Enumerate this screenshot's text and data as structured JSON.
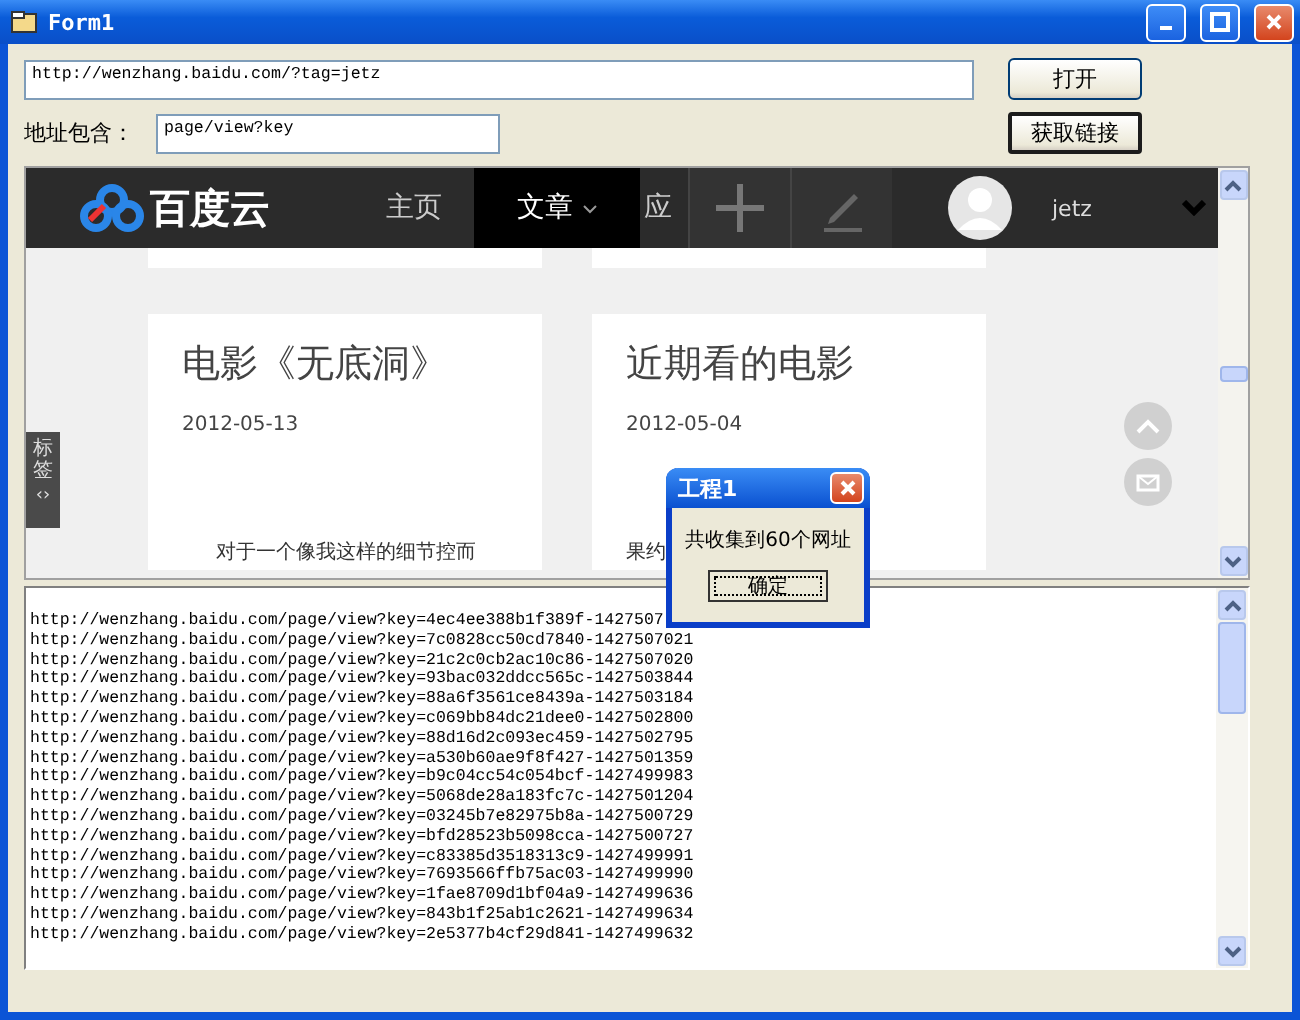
{
  "window": {
    "title": "Form1"
  },
  "url_field": {
    "value": "http://wenzhang.baidu.com/?tag=jetz"
  },
  "open_button": "打开",
  "filter": {
    "label": "地址包含：",
    "value": "page/view?key"
  },
  "fetch_button": "获取链接",
  "browser": {
    "nav": {
      "logo": "百度云",
      "items": [
        {
          "label": "主页",
          "selected": false,
          "dropdown": false
        },
        {
          "label": "文章",
          "selected": true,
          "dropdown": true
        },
        {
          "label": "应",
          "selected": false,
          "dropdown": false
        }
      ],
      "user": "jetz"
    },
    "side_tab": {
      "label": "标签",
      "arrows": "‹›"
    },
    "cards": [
      {
        "title": "电影《无底洞》",
        "date": "2012-05-13",
        "excerpt": "对于一个像我这样的细节控而"
      },
      {
        "title": "近期看的电影",
        "date": "2012-05-04",
        "excerpt": "果约"
      }
    ]
  },
  "links": [
    "http://wenzhang.baidu.com/page/view?key=4ec4ee388b1f389f-1427507",
    "http://wenzhang.baidu.com/page/view?key=7c0828cc50cd7840-1427507021",
    "http://wenzhang.baidu.com/page/view?key=21c2c0cb2ac10c86-1427507020",
    "http://wenzhang.baidu.com/page/view?key=93bac032ddcc565c-1427503844",
    "http://wenzhang.baidu.com/page/view?key=88a6f3561ce8439a-1427503184",
    "http://wenzhang.baidu.com/page/view?key=c069bb84dc21dee0-1427502800",
    "http://wenzhang.baidu.com/page/view?key=88d16d2c093ec459-1427502795",
    "http://wenzhang.baidu.com/page/view?key=a530b60ae9f8f427-1427501359",
    "http://wenzhang.baidu.com/page/view?key=b9c04cc54c054bcf-1427499983",
    "http://wenzhang.baidu.com/page/view?key=5068de28a183fc7c-1427501204",
    "http://wenzhang.baidu.com/page/view?key=03245b7e82975b8a-1427500729",
    "http://wenzhang.baidu.com/page/view?key=bfd28523b5098cca-1427500727",
    "http://wenzhang.baidu.com/page/view?key=c83385d3518313c9-1427499991",
    "http://wenzhang.baidu.com/page/view?key=7693566ffb75ac03-1427499990",
    "http://wenzhang.baidu.com/page/view?key=1fae8709d1bf04a9-1427499636",
    "http://wenzhang.baidu.com/page/view?key=843b1f25ab1c2621-1427499634",
    "http://wenzhang.baidu.com/page/view?key=2e5377b4cf29d841-1427499632"
  ],
  "dialog": {
    "title": "工程1",
    "message": "共收集到60个网址",
    "button": "确定"
  }
}
